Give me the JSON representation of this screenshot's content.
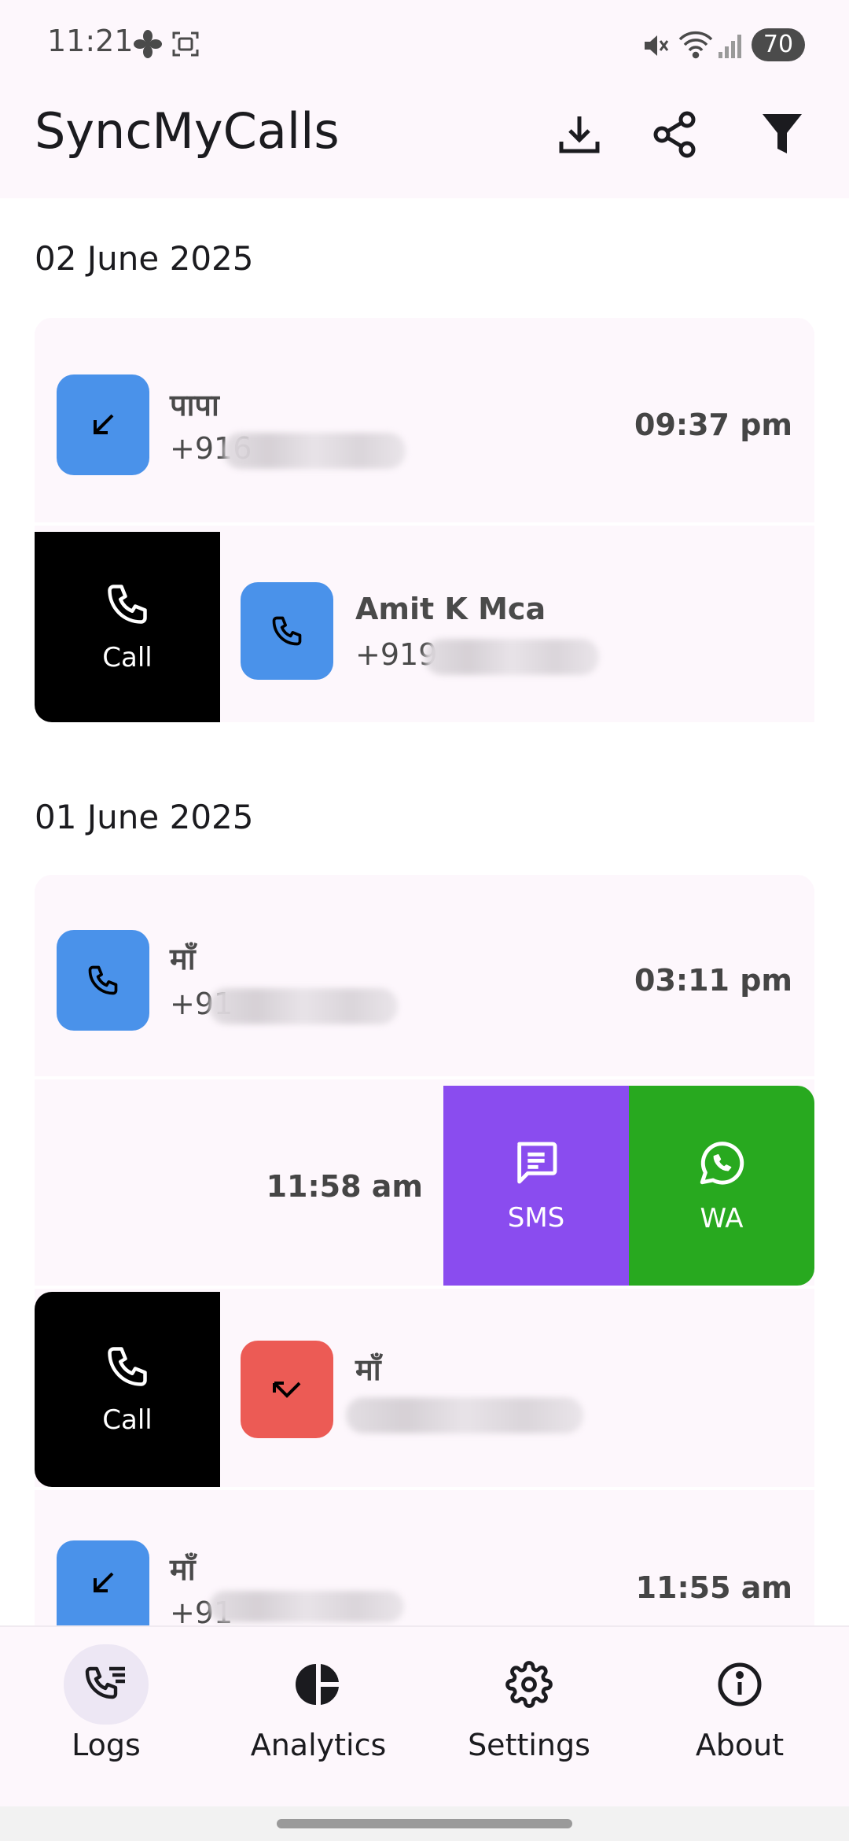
{
  "status_bar": {
    "time": "11:21",
    "battery": "70"
  },
  "app_bar": {
    "title": "SyncMyCalls",
    "actions": [
      "download-icon",
      "share-icon",
      "filter-icon"
    ]
  },
  "sections": [
    {
      "date": "02 June 2025",
      "entries": [
        {
          "name": "पापा",
          "number": "+916",
          "time": "09:37 pm",
          "type": "incoming"
        },
        {
          "name": "Amit K Mca",
          "number": "+919",
          "swipe_action": "Call",
          "type": "outgoing"
        }
      ]
    },
    {
      "date": "01 June 2025",
      "entries": [
        {
          "name": "माँ",
          "number": "+91",
          "time": "03:11 pm",
          "type": "outgoing"
        },
        {
          "time": "11:58 am",
          "actions": [
            "SMS",
            "WA"
          ]
        },
        {
          "name": "माँ",
          "number": "",
          "swipe_action": "Call",
          "type": "missed"
        },
        {
          "name": "माँ",
          "number": "+91",
          "time": "11:55 am",
          "type": "incoming"
        }
      ]
    }
  ],
  "bottom_nav": [
    {
      "label": "Logs",
      "icon": "call-log-icon",
      "active": true
    },
    {
      "label": "Analytics",
      "icon": "pie-chart-icon"
    },
    {
      "label": "Settings",
      "icon": "gear-icon"
    },
    {
      "label": "About",
      "icon": "info-icon"
    }
  ],
  "colors": {
    "surface": "#fdf7fc",
    "call_type_blue": "#4a92ea",
    "missed_red": "#ec5b55",
    "sms_purple": "#8a4cef",
    "whatsapp_green": "#28a91f",
    "call_action_black": "#000000"
  }
}
